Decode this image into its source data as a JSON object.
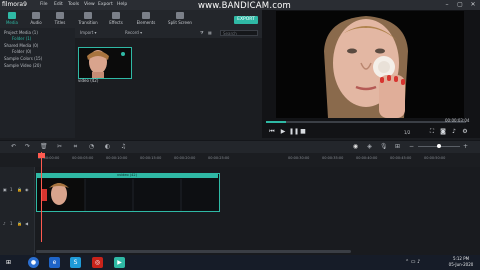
{
  "app": {
    "title": "filmora9"
  },
  "menu": [
    "File",
    "Edit",
    "Tools",
    "View",
    "Export",
    "Help"
  ],
  "watermark": "www.BANDICAM.com",
  "toolbar": {
    "tools": [
      {
        "label": "Media",
        "color": "#2fb9a5"
      },
      {
        "label": "Audio",
        "color": "#7b8089"
      },
      {
        "label": "Titles",
        "color": "#7b8089"
      },
      {
        "label": "Transition",
        "color": "#7b8089"
      },
      {
        "label": "Effects",
        "color": "#7b8089"
      },
      {
        "label": "Elements",
        "color": "#7b8089"
      },
      {
        "label": "Split Screen",
        "color": "#7b8089"
      }
    ],
    "export_label": "EXPORT"
  },
  "library": {
    "items": [
      "Project Media (1)",
      "Folder (1)",
      "Shared Media (0)",
      "Folder (0)",
      "Sample Colors (15)",
      "Sample Video (20)"
    ]
  },
  "media": {
    "import_label": "Import",
    "record_label": "Record",
    "search_placeholder": "Search",
    "thumbnail_label": "video (42)"
  },
  "preview": {
    "progress_fraction": 0.1,
    "timecode": "00:00:03:04",
    "page_label": "1/2"
  },
  "timeline": {
    "ticks": [
      "00:00:00:00",
      "00:00:05:00",
      "00:00:10:00",
      "00:00:15:00",
      "00:00:20:00",
      "00:00:25:00",
      "00:00:30:00",
      "00:00:35:00",
      "00:00:40:00",
      "00:00:45:00",
      "00:00:50:00"
    ],
    "clip_name": "vvideo (42)",
    "track_labels": [
      "1",
      "1"
    ]
  },
  "taskbar": {
    "time": "5:12 PM",
    "date": "05-Jun-2020"
  },
  "colors": {
    "accent": "#2fb9a5",
    "playhead": "#ff5a4f"
  }
}
